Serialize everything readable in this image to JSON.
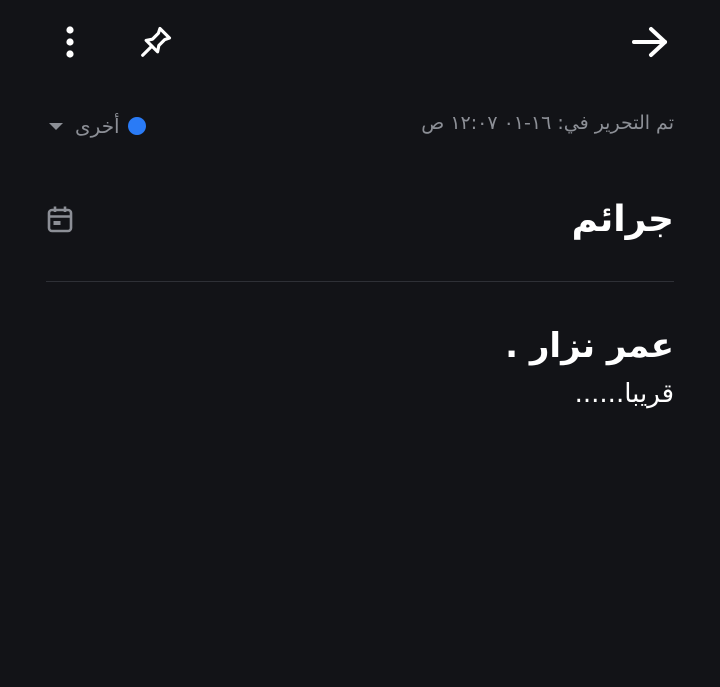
{
  "toolbar": {
    "menu_icon": "more-vertical-icon",
    "pin_icon": "pin-icon",
    "back_icon": "arrow-right-icon"
  },
  "meta": {
    "edited_label": "تم التحرير في: ١٦-٠١ ١٢:٠٧ ص",
    "category_label": "أخرى",
    "category_color": "#2a7bf6",
    "category_dropdown_icon": "caret-down-icon"
  },
  "note": {
    "title": "جرائم",
    "calendar_icon": "calendar-icon",
    "body_line_1": "عمر نزار .",
    "body_line_2": "قريبا......"
  },
  "colors": {
    "background": "#121317",
    "text": "#ffffff",
    "muted_text": "#8c8f96",
    "divider": "#2e3036",
    "accent": "#2a7bf6"
  }
}
